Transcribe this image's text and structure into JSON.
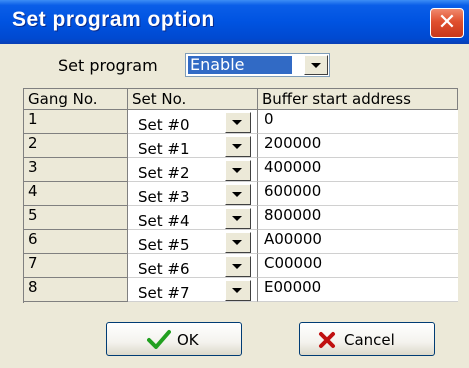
{
  "dialog": {
    "title": "Set program option",
    "close_glyph": "✕"
  },
  "set_program": {
    "label": "Set program",
    "value": "Enable"
  },
  "table": {
    "headers": [
      "Gang No.",
      "Set No.",
      "Buffer start address"
    ],
    "rows": [
      {
        "gang": "1",
        "set": "Set #0",
        "address": "0"
      },
      {
        "gang": "2",
        "set": "Set #1",
        "address": "200000"
      },
      {
        "gang": "3",
        "set": "Set #2",
        "address": "400000"
      },
      {
        "gang": "4",
        "set": "Set #3",
        "address": "600000"
      },
      {
        "gang": "5",
        "set": "Set #4",
        "address": "800000"
      },
      {
        "gang": "6",
        "set": "Set #5",
        "address": "A00000"
      },
      {
        "gang": "7",
        "set": "Set #6",
        "address": "C00000"
      },
      {
        "gang": "8",
        "set": "Set #7",
        "address": "E00000"
      }
    ]
  },
  "buttons": {
    "ok_label": "OK",
    "cancel_label": "Cancel"
  },
  "colors": {
    "titlebar": "#0053e1",
    "selection": "#316ac5",
    "ok_icon": "#22a020",
    "cancel_icon": "#c01010"
  },
  "icons": {
    "ok": "check-icon",
    "cancel": "x-icon",
    "close": "close-icon"
  }
}
